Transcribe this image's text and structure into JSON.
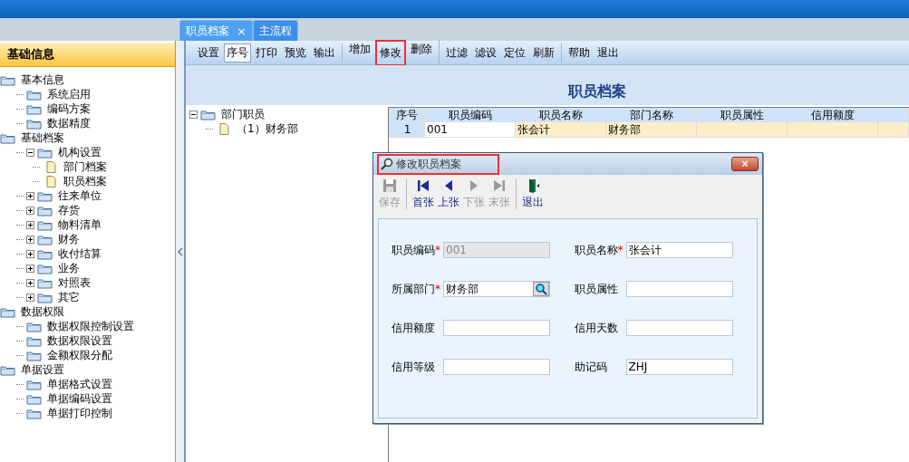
{
  "tabs": [
    {
      "label": "职员档案",
      "selected": true,
      "close": "×"
    },
    {
      "label": "主流程",
      "selected": false
    }
  ],
  "sidebar": {
    "title": "基础信息",
    "items": [
      {
        "label": "基本信息",
        "kind": "folder",
        "children": [
          {
            "label": "系统启用",
            "kind": "folder"
          },
          {
            "label": "编码方案",
            "kind": "folder"
          },
          {
            "label": "数据精度",
            "kind": "folder"
          }
        ]
      },
      {
        "label": "基础档案",
        "kind": "folder",
        "children": [
          {
            "label": "机构设置",
            "kind": "folder",
            "expanded": true,
            "children": [
              {
                "label": "部门档案",
                "kind": "doc"
              },
              {
                "label": "职员档案",
                "kind": "doc"
              }
            ]
          },
          {
            "label": "往来单位",
            "kind": "folder",
            "expanded": false
          },
          {
            "label": "存货",
            "kind": "folder",
            "expanded": false
          },
          {
            "label": "物料清单",
            "kind": "folder",
            "expanded": false
          },
          {
            "label": "财务",
            "kind": "folder",
            "expanded": false
          },
          {
            "label": "收付结算",
            "kind": "folder",
            "expanded": false
          },
          {
            "label": "业务",
            "kind": "folder",
            "expanded": false
          },
          {
            "label": "对照表",
            "kind": "folder",
            "expanded": false
          },
          {
            "label": "其它",
            "kind": "folder",
            "expanded": false
          }
        ]
      },
      {
        "label": "数据权限",
        "kind": "folder",
        "children": [
          {
            "label": "数据权限控制设置",
            "kind": "folder"
          },
          {
            "label": "数据权限设置",
            "kind": "folder"
          },
          {
            "label": "金额权限分配",
            "kind": "folder"
          }
        ]
      },
      {
        "label": "单据设置",
        "kind": "folder",
        "children": [
          {
            "label": "单据格式设置",
            "kind": "folder"
          },
          {
            "label": "单据编码设置",
            "kind": "folder"
          },
          {
            "label": "单据打印控制",
            "kind": "folder"
          }
        ]
      }
    ]
  },
  "toolbar": {
    "groups": [
      [
        {
          "label": "设置",
          "pressed": false,
          "highlighted": false
        },
        {
          "label": "序号",
          "pressed": true,
          "highlighted": false
        },
        {
          "label": "打印",
          "pressed": false,
          "highlighted": false
        },
        {
          "label": "预览",
          "pressed": false,
          "highlighted": false
        },
        {
          "label": "输出",
          "pressed": false,
          "highlighted": false
        }
      ],
      [
        {
          "label": "增加",
          "pressed": false,
          "highlighted": false
        },
        {
          "label": "修改",
          "pressed": false,
          "highlighted": true
        },
        {
          "label": "删除",
          "pressed": false,
          "highlighted": false
        }
      ],
      [
        {
          "label": "过滤",
          "pressed": false,
          "highlighted": false
        },
        {
          "label": "滤设",
          "pressed": false,
          "highlighted": false
        },
        {
          "label": "定位",
          "pressed": false,
          "highlighted": false
        },
        {
          "label": "刷新",
          "pressed": false,
          "highlighted": false
        }
      ],
      [
        {
          "label": "帮助",
          "pressed": false,
          "highlighted": false
        },
        {
          "label": "退出",
          "pressed": false,
          "highlighted": false
        }
      ]
    ]
  },
  "page_title": "职员档案",
  "department_tree": [
    {
      "label": "部门职员",
      "kind": "folder",
      "expanded": true,
      "children": [
        {
          "label": "（1）财务部",
          "kind": "doc"
        }
      ]
    }
  ],
  "table": {
    "columns": [
      "序号",
      "职员编码",
      "职员名称",
      "部门名称",
      "职员属性",
      "信用额度"
    ],
    "rows": [
      {
        "selected": true,
        "cells": [
          "1",
          "001",
          "张会计",
          "财务部"
        ]
      }
    ]
  },
  "dialog": {
    "title": "修改职员档案",
    "title_highlighted": true,
    "close": "×",
    "toolbar": [
      {
        "kind": "save",
        "label": "保存",
        "disabled": true,
        "separator_after": true
      },
      {
        "kind": "first",
        "label": "首张",
        "disabled": false
      },
      {
        "kind": "prev",
        "label": "上张",
        "disabled": false
      },
      {
        "kind": "next",
        "label": "下张",
        "disabled": true
      },
      {
        "kind": "last",
        "label": "末张",
        "disabled": true,
        "separator_after": true
      },
      {
        "kind": "exit",
        "label": "退出",
        "disabled": false
      }
    ],
    "fields": [
      {
        "label": "职员编码",
        "required_mark": "*",
        "value": "001",
        "disabled": true
      },
      {
        "label": "职员名称",
        "required_mark": "*",
        "value": "张会计",
        "disabled": false
      },
      {
        "label": "所属部门",
        "required_mark": "*",
        "value": "财务部",
        "disabled": false,
        "lookup": true
      },
      {
        "label": "职员属性",
        "disabled": false
      },
      {
        "label": "信用额度",
        "disabled": false
      },
      {
        "label": "信用天数",
        "disabled": false
      },
      {
        "label": "信用等级",
        "disabled": false
      },
      {
        "label": "助记码",
        "value": "ZHJ",
        "disabled": false
      }
    ]
  }
}
